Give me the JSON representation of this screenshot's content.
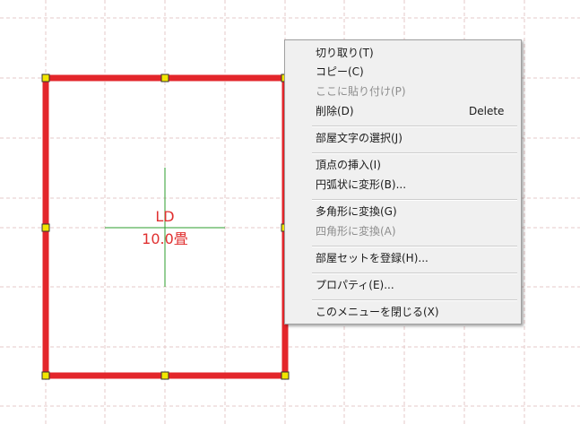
{
  "room": {
    "name": "LD",
    "area": "10.0畳",
    "line_color": "#e3262b",
    "handle_color": "#f2e600",
    "axis_color": "#2e9e2e",
    "text_color": "#e03030"
  },
  "grid": {
    "line_color": "#e4c8c8"
  },
  "context_menu": {
    "items": [
      {
        "label": "切り取り(T)",
        "enabled": true
      },
      {
        "label": "コピー(C)",
        "enabled": true
      },
      {
        "label": "ここに貼り付け(P)",
        "enabled": false
      },
      {
        "label": "削除(D)",
        "shortcut": "Delete",
        "enabled": true
      },
      {
        "label": "部屋文字の選択(J)",
        "enabled": true
      },
      {
        "label": "頂点の挿入(I)",
        "enabled": true
      },
      {
        "label": "円弧状に変形(B)...",
        "enabled": true
      },
      {
        "label": "多角形に変換(G)",
        "enabled": true
      },
      {
        "label": "四角形に変換(A)",
        "enabled": false
      },
      {
        "label": "部屋セットを登録(H)...",
        "enabled": true
      },
      {
        "label": "プロパティ(E)...",
        "enabled": true
      },
      {
        "label": "このメニューを閉じる(X)",
        "enabled": true
      }
    ]
  }
}
